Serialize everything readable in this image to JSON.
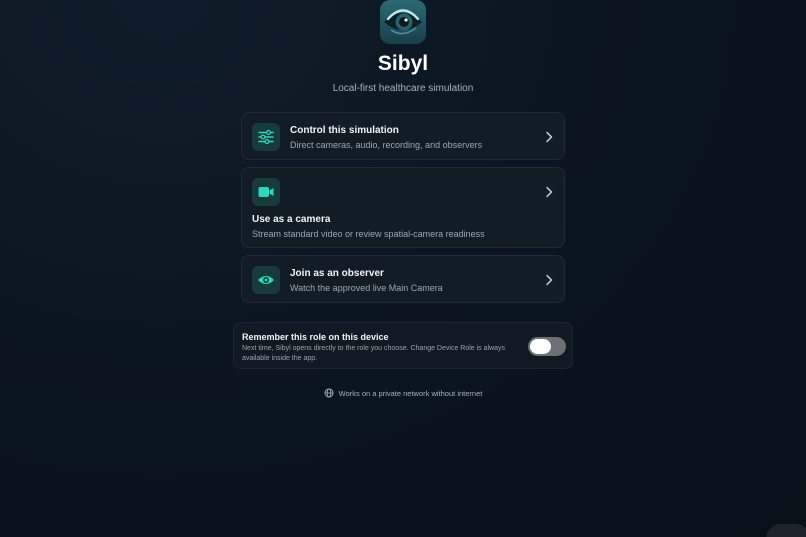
{
  "app": {
    "name": "Sibyl",
    "tagline": "Local-first healthcare simulation",
    "logo_icon": "eye-logo-icon"
  },
  "roles": [
    {
      "title": "Control this simulation",
      "description": "Direct cameras, audio, recording, and observers",
      "icon": "sliders-icon"
    },
    {
      "title": "Use as a camera",
      "description": "Stream standard video or review spatial-camera readiness",
      "icon": "video-camera-icon"
    },
    {
      "title": "Join as an observer",
      "description": "Watch the approved live Main Camera",
      "icon": "eye-icon"
    }
  ],
  "remember": {
    "title": "Remember this role on this device",
    "description": "Next time, Sibyl opens directly to the role you choose. Change Device Role is always available inside the app.",
    "toggle_on": false
  },
  "footer": {
    "text": "Works on a private network without internet",
    "icon": "network-icon"
  },
  "colors": {
    "accent": "#2fd6c0",
    "background": "#0b1520",
    "card": "#121c25",
    "icon_tile": "#173b3a"
  }
}
